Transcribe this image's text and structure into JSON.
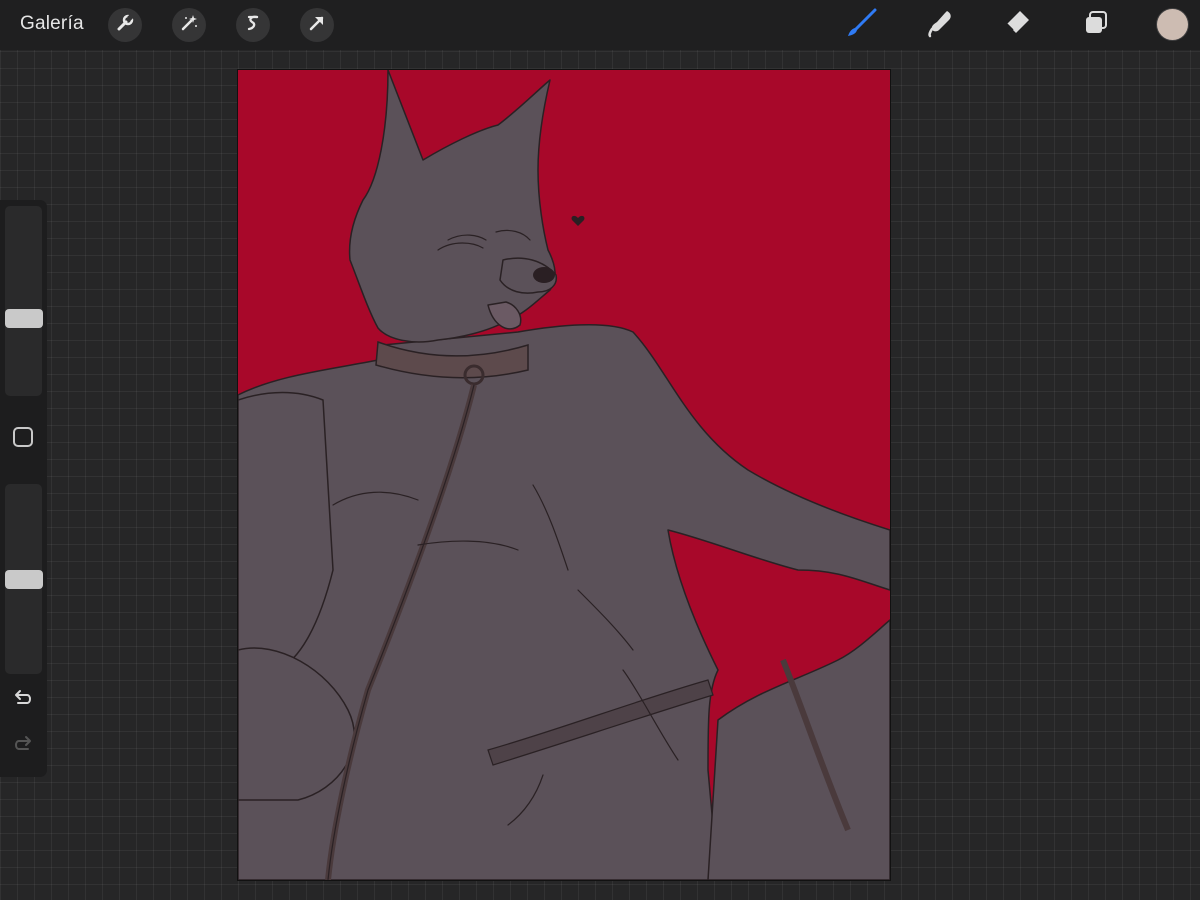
{
  "toolbar": {
    "gallery_label": "Galería",
    "left_tools": [
      {
        "icon": "wrench-icon",
        "name": "actions"
      },
      {
        "icon": "magic-wand-icon",
        "name": "adjustments"
      },
      {
        "icon": "selection-icon",
        "name": "selection"
      },
      {
        "icon": "transform-arrow-icon",
        "name": "transform"
      }
    ],
    "right_tools": [
      {
        "icon": "brush-icon",
        "name": "paint",
        "active": true
      },
      {
        "icon": "smudge-icon",
        "name": "smudge"
      },
      {
        "icon": "eraser-icon",
        "name": "erase"
      },
      {
        "icon": "layers-icon",
        "name": "layers"
      }
    ],
    "active_color": "#cdbcb2",
    "active_tool_color": "#2f7bf5"
  },
  "sidebar": {
    "brush_size_level": 0.6,
    "opacity_level": 0.5
  },
  "canvas": {
    "background_color": "#a8082a",
    "figure_color": "#5b5159"
  }
}
